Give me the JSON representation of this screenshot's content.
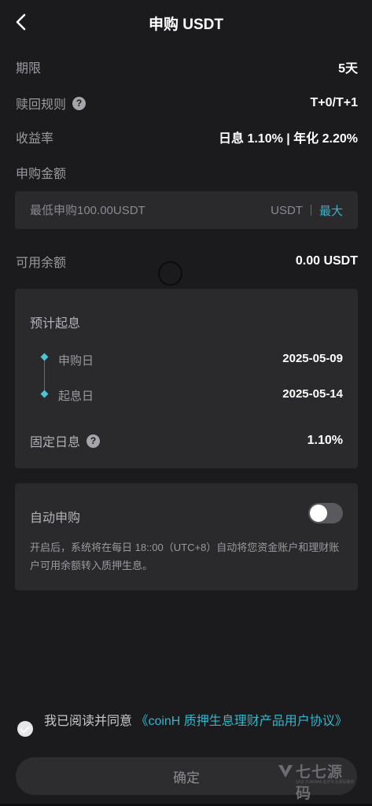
{
  "header": {
    "title": "申购 USDT",
    "back_icon": "chevron-left-icon"
  },
  "info": {
    "term_label": "期限",
    "term_value": "5天",
    "redeem_label": "赎回规则",
    "redeem_value": "T+0/T+1",
    "yield_label": "收益率",
    "yield_value": "日息 1.10% | 年化 2.20%"
  },
  "amount": {
    "label": "申购金额",
    "placeholder": "最低申购100.00USDT",
    "value": "",
    "currency": "USDT",
    "max_label": "最大"
  },
  "balance": {
    "label": "可用余额",
    "value": "0.00 USDT"
  },
  "schedule": {
    "title": "预计起息",
    "subscribe_label": "申购日",
    "subscribe_date": "2025-05-09",
    "start_label": "起息日",
    "start_date": "2025-05-14",
    "fixed_label": "固定日息",
    "fixed_value": "1.10%"
  },
  "auto": {
    "title": "自动申购",
    "enabled": false,
    "description": "开启后，系统将在每日 18::00（UTC+8）自动将您资金账户和理财账户可用余额转入质押生息。"
  },
  "agreement": {
    "text": "我已阅读并同意 ",
    "link": "《coinH 质押生息理财产品用户协议》",
    "checked": true
  },
  "confirm_label": "确定",
  "watermark": {
    "text": "七七源码",
    "sub": "QIQI YUANMA 提供专业源码服务"
  },
  "colors": {
    "background": "#1b1b1d",
    "card": "#2a2a2d",
    "accent": "#33b5c9"
  }
}
